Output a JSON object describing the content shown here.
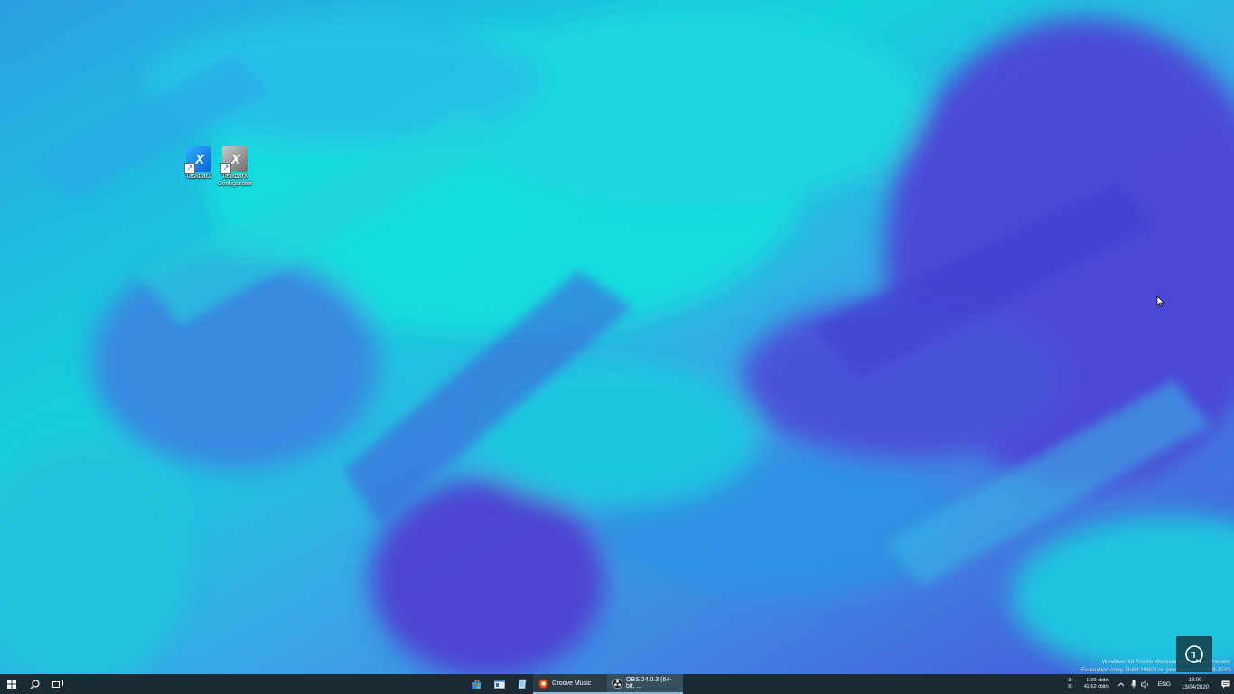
{
  "desktop": {
    "icons": [
      {
        "label": "TaskbarX",
        "icon": "taskbarx-icon"
      },
      {
        "label": "TaskbarX Configurator",
        "icon": "taskbarx-configurator-icon"
      }
    ],
    "watermark": {
      "line1": "Windows 10 Pro for Workstations Insider Preview",
      "line2": "Evaluation copy. Build 19603.rs_prerelease.200409-1523"
    }
  },
  "taskbar": {
    "start_icon": "windows-logo-icon",
    "search_icon": "search-icon",
    "task_view_icon": "task-view-icon",
    "pinned": [
      {
        "name": "microsoft-store",
        "icon": "store-icon"
      },
      {
        "name": "file-explorer",
        "icon": "window-icon"
      },
      {
        "name": "notepad",
        "icon": "notepad-icon"
      }
    ],
    "apps": [
      {
        "label": "Groove Music",
        "icon": "groove-music-icon"
      },
      {
        "label": "OBS 24.0.3 (64-bit, ...",
        "icon": "obs-icon"
      }
    ],
    "tray": {
      "upload_label": "U:",
      "download_label": "D:",
      "upload_speed": "0.00 kbit/s",
      "download_speed": "42.62 kbit/s",
      "language": "ENG",
      "time": "18:00",
      "date": "13/04/2020"
    }
  },
  "colors": {
    "taskbar_bg": "#1c2a33",
    "wallpaper_cyan": "#14d6dc",
    "wallpaper_blue": "#3aa9e8",
    "wallpaper_violet": "#4b4ad8"
  }
}
